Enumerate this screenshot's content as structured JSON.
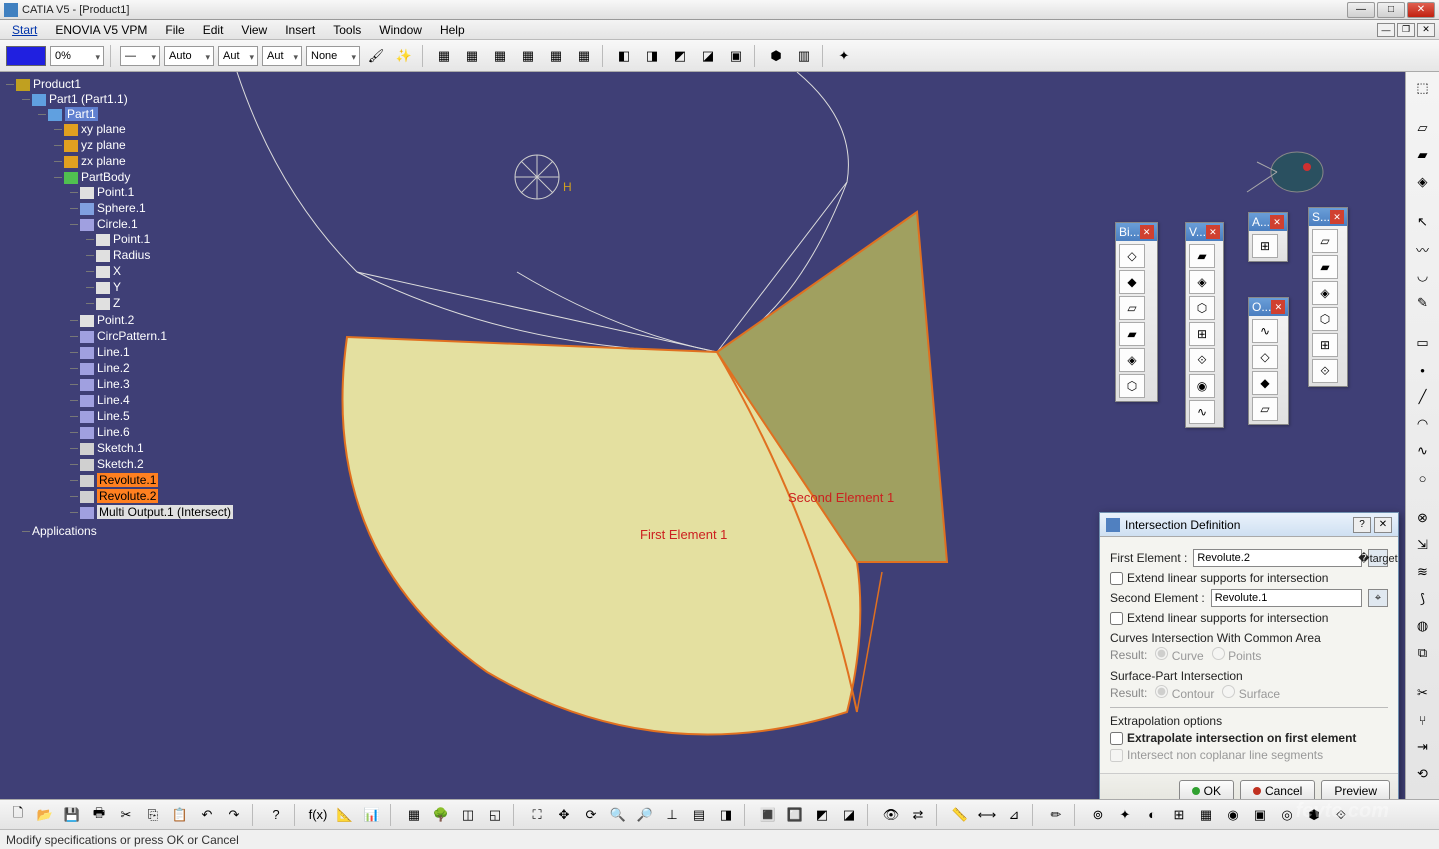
{
  "title": "CATIA V5 - [Product1]",
  "menubar": [
    "Start",
    "ENOVIA V5 VPM",
    "File",
    "Edit",
    "View",
    "Insert",
    "Tools",
    "Window",
    "Help"
  ],
  "toolbar": {
    "opacity": "0%",
    "lineStyle": "—",
    "auto1": "Auto",
    "auto2": "Aut",
    "auto3": "Aut",
    "none": "None"
  },
  "tree": {
    "root": "Product1",
    "partInst": "Part1 (Part1.1)",
    "part": "Part1",
    "planes": [
      "xy plane",
      "yz plane",
      "zx plane"
    ],
    "body": "PartBody",
    "bodyItems": [
      {
        "n": "Point.1",
        "t": "pt"
      },
      {
        "n": "Sphere.1",
        "t": "sph"
      },
      {
        "n": "Circle.1",
        "t": "ln",
        "children": [
          "Point.1",
          "Radius",
          "X",
          "Y",
          "Z"
        ]
      },
      {
        "n": "Point.2",
        "t": "pt"
      },
      {
        "n": "CircPattern.1",
        "t": "ln"
      },
      {
        "n": "Line.1",
        "t": "ln"
      },
      {
        "n": "Line.2",
        "t": "ln"
      },
      {
        "n": "Line.3",
        "t": "ln"
      },
      {
        "n": "Line.4",
        "t": "ln"
      },
      {
        "n": "Line.5",
        "t": "ln"
      },
      {
        "n": "Line.6",
        "t": "ln"
      },
      {
        "n": "Sketch.1",
        "t": "sk"
      },
      {
        "n": "Sketch.2",
        "t": "sk"
      },
      {
        "n": "Revolute.1",
        "t": "sk",
        "sel": true
      },
      {
        "n": "Revolute.2",
        "t": "sk",
        "sel": true
      },
      {
        "n": "Multi Output.1 (Intersect)",
        "t": "ln",
        "msel": true
      }
    ],
    "apps": "Applications"
  },
  "annotations": {
    "first": "First Element 1",
    "second": "Second Element 1"
  },
  "palettes": [
    {
      "t": "Bi...",
      "n": 6
    },
    {
      "t": "V...",
      "n": 7
    },
    {
      "t": "A...",
      "n": 1
    },
    {
      "t": "O...",
      "n": 4
    },
    {
      "t": "S...",
      "n": 6
    }
  ],
  "dialog": {
    "title": "Intersection Definition",
    "firstLabel": "First Element :",
    "firstVal": "Revolute.2",
    "ext1": "Extend linear supports for intersection",
    "secondLabel": "Second Element :",
    "secondVal": "Revolute.1",
    "ext2": "Extend linear supports for intersection",
    "curvesSect": "Curves Intersection With Common Area",
    "resultLbl": "Result:",
    "curve": "Curve",
    "points": "Points",
    "surfSect": "Surface-Part Intersection",
    "contour": "Contour",
    "surface": "Surface",
    "extrapSect": "Extrapolation options",
    "extrap1": "Extrapolate intersection on first element",
    "extrap2": "Intersect non coplanar line segments",
    "ok": "OK",
    "cancel": "Cancel",
    "preview": "Preview"
  },
  "status": "Modify specifications or press OK or Cancel",
  "watermark": "fevte.com"
}
